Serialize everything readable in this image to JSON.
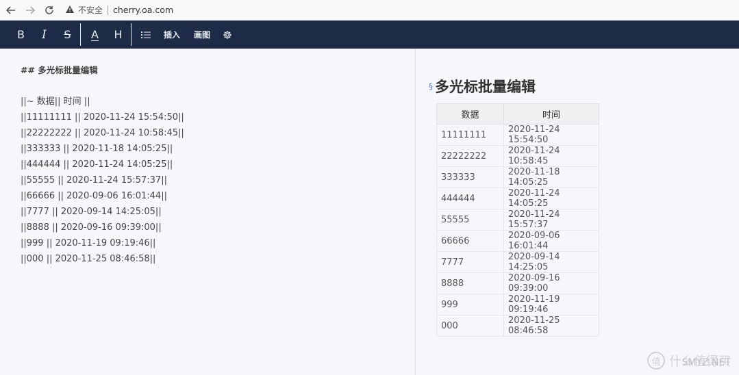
{
  "browser": {
    "back_icon": "arrow-left-icon",
    "forward_icon": "arrow-right-icon",
    "reload_icon": "reload-icon",
    "warning_icon": "warning-triangle-icon",
    "insecure_label": "不安全",
    "url": "cherry.oa.com"
  },
  "toolbar": {
    "bold": "B",
    "italic": "I",
    "strike": "S",
    "color": "A",
    "header": "H",
    "list_icon": "list-icon",
    "insert": "插入",
    "draw": "画图",
    "settings_icon": "gear-icon"
  },
  "editor": {
    "heading": "## 多光标批量编辑",
    "lines": [
      "||~ 数据|| 时间 ||",
      "||11111111 || 2020-11-24 15:54:50||",
      "||22222222 || 2020-11-24 10:58:45||",
      "||333333 || 2020-11-18 14:05:25||",
      "||444444 || 2020-11-24 14:05:25||",
      "||55555 || 2020-11-24 15:57:37||",
      "||66666 || 2020-09-06 16:01:44||",
      "||7777 || 2020-09-14 14:25:05||",
      "||8888 || 2020-09-16 09:39:00||",
      "||999 || 2020-11-19 09:19:46||",
      "||000 || 2020-11-25 08:46:58||"
    ]
  },
  "preview": {
    "anchor": "§",
    "title": "多光标批量编辑",
    "headers": [
      "数据",
      "时间"
    ],
    "rows": [
      [
        "11111111",
        "2020-11-24 15:54:50"
      ],
      [
        "22222222",
        "2020-11-24 10:58:45"
      ],
      [
        "333333",
        "2020-11-18 14:05:25"
      ],
      [
        "444444",
        "2020-11-24 14:05:25"
      ],
      [
        "55555",
        "2020-11-24 15:57:37"
      ],
      [
        "66666",
        "2020-09-06 16:01:44"
      ],
      [
        "7777",
        "2020-09-14 14:25:05"
      ],
      [
        "8888",
        "2020-09-16 09:39:00"
      ],
      [
        "999",
        "2020-11-19 09:19:46"
      ],
      [
        "000",
        "2020-11-25 08:46:58"
      ]
    ]
  },
  "watermark": {
    "icon": "值",
    "text": "什么值得买",
    "site": "SMYZ.NET"
  }
}
